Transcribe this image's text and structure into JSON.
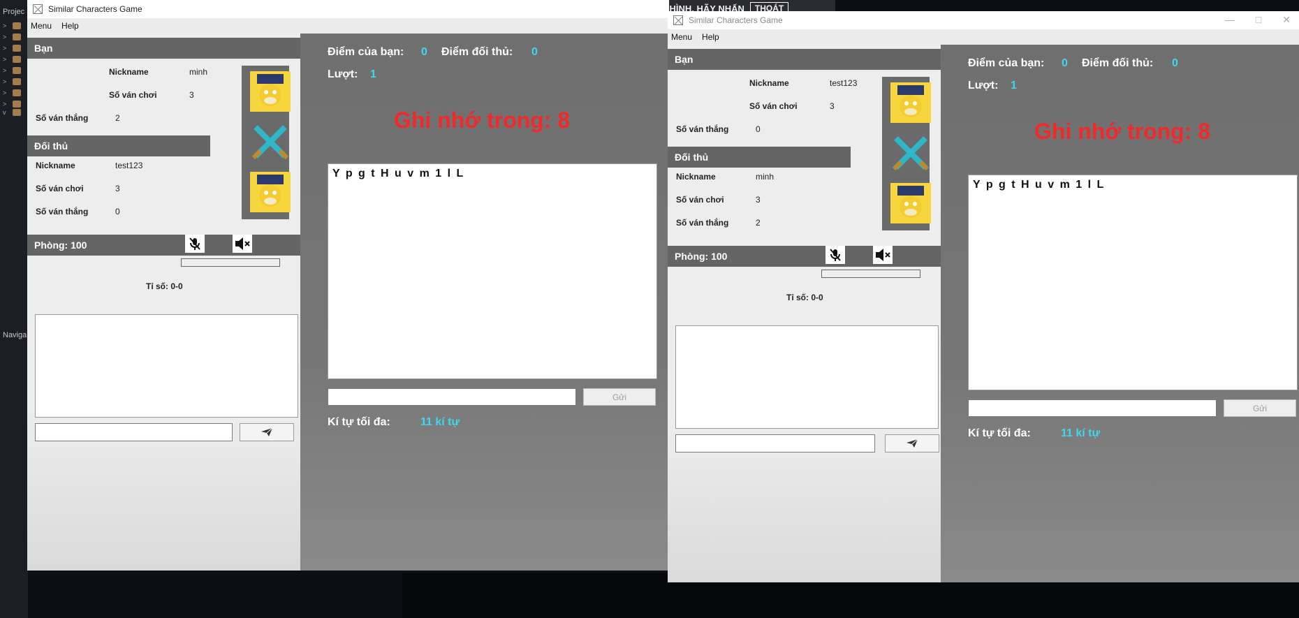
{
  "ide": {
    "project_label": "Projec",
    "navigator_label": "Naviga"
  },
  "banner": {
    "text": "ĐỂ THOÁT KHỎI CHẾ ĐỘ TOÀN MÀN HÌNH, HÃY NHẤN",
    "exit_label": "THOÁT"
  },
  "windows": [
    {
      "title": "Similar Characters Game",
      "menu": [
        "Menu",
        "Help"
      ],
      "you": {
        "header": "Bạn",
        "nickname_label": "Nickname",
        "nickname": "minh",
        "games_label": "Số ván chơi",
        "games": "3",
        "wins_label": "Số ván thắng",
        "wins": "2"
      },
      "opponent": {
        "header": "Đối thủ",
        "nickname_label": "Nickname",
        "nickname": "test123",
        "games_label": "Số ván chơi",
        "games": "3",
        "wins_label": "Số ván thắng",
        "wins": "0"
      },
      "room": "Phòng: 100",
      "score_text": "Tỉ số: 0-0",
      "send_icon": "paper-plane-icon",
      "game": {
        "your_score_label": "Điểm của bạn:",
        "your_score": "0",
        "opp_score_label": "Điểm đối thủ:",
        "opp_score": "0",
        "turn_label": "Lượt:",
        "turn": "1",
        "memorize_text": "Ghi nhớ trong: 8",
        "characters": "Y p g t H u v m 1 l L",
        "submit_label": "Gửi",
        "max_chars_label": "Kí tự tối đa:",
        "max_chars": "11 kí tự"
      }
    },
    {
      "title": "Similar Characters Game",
      "menu": [
        "Menu",
        "Help"
      ],
      "you": {
        "header": "Bạn",
        "nickname_label": "Nickname",
        "nickname": "test123",
        "games_label": "Số ván chơi",
        "games": "3",
        "wins_label": "Số ván thắng",
        "wins": "0"
      },
      "opponent": {
        "header": "Đối thủ",
        "nickname_label": "Nickname",
        "nickname": "minh",
        "games_label": "Số ván chơi",
        "games": "3",
        "wins_label": "Số ván thắng",
        "wins": "2"
      },
      "room": "Phòng: 100",
      "score_text": "Tỉ số: 0-0",
      "send_icon": "paper-plane-icon",
      "game": {
        "your_score_label": "Điểm của bạn:",
        "your_score": "0",
        "opp_score_label": "Điểm đối thủ:",
        "opp_score": "0",
        "turn_label": "Lượt:",
        "turn": "1",
        "memorize_text": "Ghi nhớ trong: 8",
        "characters": "Y p g t H u v m 1 l L",
        "submit_label": "Gửi",
        "max_chars_label": "Kí tự tối đa:",
        "max_chars": "11 kí tự"
      }
    }
  ],
  "colors": {
    "accent_value": "#3fd7f2",
    "timer": "#f02a2a",
    "header_bg": "#656565"
  }
}
